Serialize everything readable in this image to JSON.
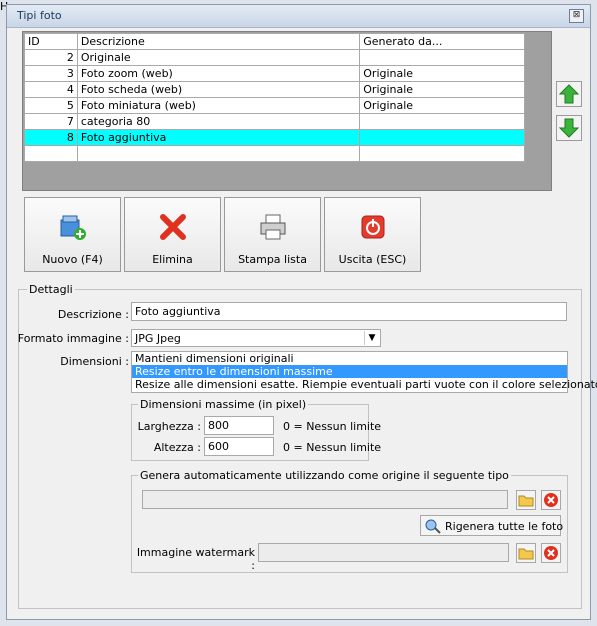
{
  "window": {
    "title": "Tipi foto",
    "close_label": "⊠"
  },
  "bg": {
    "left_char": "H"
  },
  "grid": {
    "headers": [
      "ID",
      "Descrizione",
      "Generato da..."
    ],
    "rows": [
      {
        "id": "2",
        "descrizione": "Originale",
        "generato": ""
      },
      {
        "id": "3",
        "descrizione": "Foto zoom (web)",
        "generato": "Originale"
      },
      {
        "id": "4",
        "descrizione": "Foto scheda (web)",
        "generato": "Originale"
      },
      {
        "id": "5",
        "descrizione": "Foto miniatura (web)",
        "generato": "Originale"
      },
      {
        "id": "7",
        "descrizione": "categoria 80",
        "generato": ""
      },
      {
        "id": "8",
        "descrizione": "Foto aggiuntiva",
        "generato": ""
      }
    ],
    "selected_row": 5
  },
  "toolbar": {
    "nuovo": "Nuovo (F4)",
    "elimina": "Elimina",
    "stampa": "Stampa lista",
    "uscita": "Uscita (ESC)"
  },
  "dettagli": {
    "legend": "Dettagli",
    "descrizione_label": "Descrizione :",
    "descrizione_value": "Foto aggiuntiva",
    "formato_label": "Formato immagine :",
    "formato_value": "JPG Jpeg",
    "dimensioni_label": "Dimensioni :",
    "dimensioni_options": [
      "Mantieni dimensioni originali",
      "Resize entro le dimensioni massime",
      "Resize alle dimensioni esatte. Riempie eventuali parti vuote con il colore selezionato."
    ],
    "dimensioni_selected": 1,
    "max_legend": "Dimensioni massime (in pixel)",
    "larghezza_label": "Larghezza :",
    "larghezza_value": "800",
    "altezza_label": "Altezza :",
    "altezza_value": "600",
    "nolimit_note": "0 = Nessun limite",
    "genera_legend": "Genera automaticamente utilizzando come origine il seguente tipo",
    "genera_value": "",
    "rigenera_label": "Rigenera tutte le foto",
    "watermark_label": "Immagine watermark :",
    "watermark_value": ""
  },
  "colors": {
    "selection": "#00ffff",
    "list_selection": "#3399ff"
  }
}
